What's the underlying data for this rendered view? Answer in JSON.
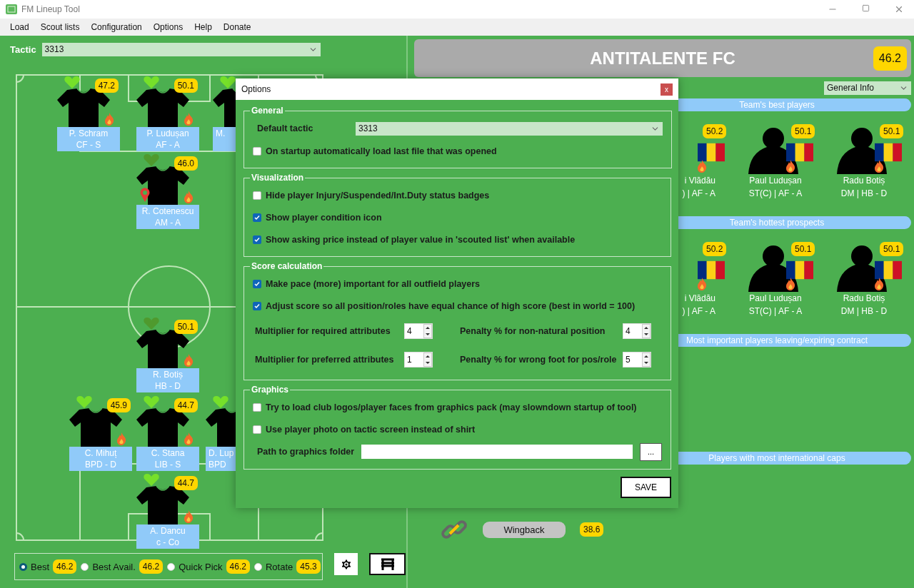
{
  "window": {
    "title": "FM Lineup Tool"
  },
  "menu": [
    "Load",
    "Scout lists",
    "Configuration",
    "Options",
    "Help",
    "Donate"
  ],
  "tactic": {
    "label": "Tactic",
    "value": "3313"
  },
  "players": [
    {
      "name": "P. Schram",
      "role": "CF - S",
      "score": "47.2",
      "color": "#76e02a",
      "hot": true,
      "marker": false
    },
    {
      "name": "P. Ludușan",
      "role": "AF - A",
      "score": "50.1",
      "color": "#76e02a",
      "hot": true,
      "marker": false
    },
    {
      "name": "M.",
      "color": "#76e02a",
      "hot": false,
      "marker": false
    },
    {
      "name": "R. Cotenescu",
      "role": "AM - A",
      "score": "46.0",
      "color": "#4f9a2e",
      "hot": true,
      "marker": true
    },
    {
      "name": "R. Botiș",
      "role": "HB - D",
      "score": "50.1",
      "color": "#4f9a2e",
      "hot": true,
      "marker": false
    },
    {
      "name": "C. Mihuț",
      "role": "BPD - D",
      "score": "45.9",
      "color": "#76e02a",
      "hot": true,
      "marker": false
    },
    {
      "name": "C. Stana",
      "role": "LIB - S",
      "score": "44.7",
      "color": "#76e02a",
      "hot": true,
      "marker": false
    },
    {
      "name": "D. Lup",
      "role": "BPD",
      "color": "#76e02a",
      "hot": false,
      "marker": false
    },
    {
      "name": "A. Dancu",
      "role": "c - Co",
      "score": "44.7",
      "color": "#76e02a",
      "hot": true,
      "marker": false
    }
  ],
  "selection": [
    {
      "label": "Best",
      "score": "46.2",
      "selected": true
    },
    {
      "label": "Best Avail.",
      "score": "46.2",
      "selected": false
    },
    {
      "label": "Quick Pick",
      "score": "46.2",
      "selected": false
    },
    {
      "label": "Rotate",
      "score": "45.3",
      "selected": false
    }
  ],
  "team": {
    "name": "ANTITALENTE FC",
    "score": "46.2"
  },
  "info_select": "General Info",
  "sections": [
    {
      "title": "Team's best players",
      "players": [
        {
          "name": "i Vlădău",
          "role": ") | AF - A",
          "score": "50.2"
        },
        {
          "name": "Paul Ludușan",
          "role": "ST(C) | AF - A",
          "score": "50.1"
        },
        {
          "name": "Radu Botiș",
          "role": "DM | HB - D",
          "score": "50.1"
        }
      ]
    },
    {
      "title": "Team's hottest prospects",
      "players": [
        {
          "name": "i Vlădău",
          "role": ") | AF - A",
          "score": "50.2"
        },
        {
          "name": "Paul Ludușan",
          "role": "ST(C) | AF - A",
          "score": "50.1"
        },
        {
          "name": "Radu Botiș",
          "role": "DM | HB - D",
          "score": "50.1"
        }
      ]
    },
    {
      "title": "Most important players leaving/expiring contract"
    },
    {
      "title": "Players with most international caps"
    }
  ],
  "role_rows": [
    {
      "role": "Wingback",
      "score": "38.6"
    }
  ],
  "options_dialog": {
    "title": "Options",
    "close": "x",
    "groups": [
      {
        "title": "General",
        "items": [
          {
            "kind": "select",
            "label": "Default tactic",
            "value": "3313"
          },
          {
            "kind": "checkbox",
            "label": "On startup automatically load last file that was opened",
            "checked": false
          }
        ]
      },
      {
        "title": "Visualization",
        "items": [
          {
            "kind": "checkbox",
            "label": "Hide player Injury/Suspended/Int.Duty status badges",
            "checked": false
          },
          {
            "kind": "checkbox",
            "label": "Show player condition icon",
            "checked": true
          },
          {
            "kind": "checkbox",
            "label": "Show asking price instead of player value in 'scouted list' when available",
            "checked": true
          }
        ]
      },
      {
        "title": "Score calculation",
        "items": [
          {
            "kind": "checkbox",
            "label": "Make pace (more) important for all outfield players",
            "checked": true
          },
          {
            "kind": "checkbox",
            "label": "Adjust score so all position/roles have equal chance of high score (best in world = 100)",
            "checked": true
          },
          {
            "kind": "spinners",
            "fields": [
              {
                "label": "Multiplier for required attributes",
                "value": "4"
              },
              {
                "label": "Penalty % for non-natural position",
                "value": "4"
              }
            ]
          },
          {
            "kind": "spinners",
            "fields": [
              {
                "label": "Multiplier for preferred attributes",
                "value": "1"
              },
              {
                "label": "Penalty % for wrong foot for pos/role",
                "value": "5"
              }
            ]
          }
        ]
      },
      {
        "title": "Graphics",
        "items": [
          {
            "kind": "checkbox",
            "label": "Try to load club logos/player faces from graphics pack (may slowndown startup of tool)",
            "checked": false
          },
          {
            "kind": "checkbox",
            "label": "Use player photo on tactic screen instead of shirt",
            "checked": false
          },
          {
            "kind": "path",
            "label": "Path to graphics folder",
            "button": "..."
          }
        ]
      }
    ],
    "save": "SAVE"
  }
}
